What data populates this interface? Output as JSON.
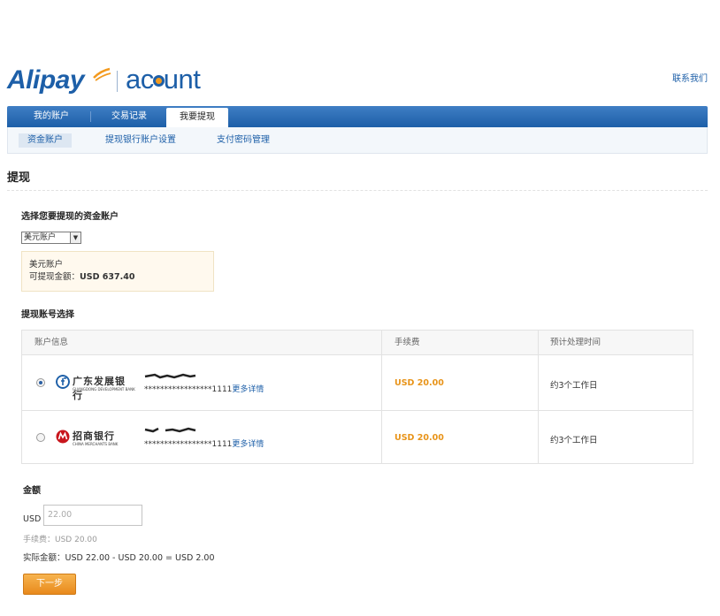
{
  "brand": {
    "logo_left": "Alipay",
    "logo_right_1": "ac",
    "logo_right_2": "unt"
  },
  "header": {
    "contact_link": "联系我们"
  },
  "nav": {
    "tabs": [
      {
        "label": "我的账户",
        "active": false
      },
      {
        "label": "交易记录",
        "active": false
      },
      {
        "label": "我要提现",
        "active": true
      }
    ]
  },
  "subnav": {
    "items": [
      {
        "label": "资金账户",
        "active": true
      },
      {
        "label": "提现银行账户设置",
        "active": false
      },
      {
        "label": "支付密码管理",
        "active": false
      }
    ]
  },
  "page": {
    "title": "提现",
    "select_account_label": "选择您要提现的资金账户",
    "account_select": {
      "selected": "美元账户"
    },
    "balance": {
      "account_name": "美元账户",
      "available_label": "可提现金额：",
      "available_amount": "USD 637.40"
    },
    "account_choice_label": "提现账号选择",
    "table": {
      "columns": [
        "账户信息",
        "手续费",
        "预计处理时间"
      ],
      "rows": [
        {
          "selected": true,
          "bank_name": "广东发展银行",
          "bank_en": "GUANGDONG DEVELOPMENT BANK",
          "account_mask": "*****************1111",
          "more_link": "更多详情",
          "fee": "USD 20.00",
          "time": "约3个工作日"
        },
        {
          "selected": false,
          "bank_name": "招商银行",
          "bank_en": "CHINA MERCHANTS BANK",
          "account_mask": "*****************1111",
          "more_link": "更多详情",
          "fee": "USD 20.00",
          "time": "约3个工作日"
        }
      ]
    },
    "amount": {
      "section_label": "金额",
      "currency": "USD",
      "value": "22.00",
      "fee_line": "手续费：USD 20.00",
      "actual_label": "实际金额：",
      "actual_calc": "USD 22.00 - USD 20.00 = USD 2.00"
    },
    "next_button": "下一步"
  },
  "colors": {
    "brand_blue": "#1d5fa8",
    "accent_orange": "#e8941a",
    "button_orange": "#ee9a2a"
  }
}
